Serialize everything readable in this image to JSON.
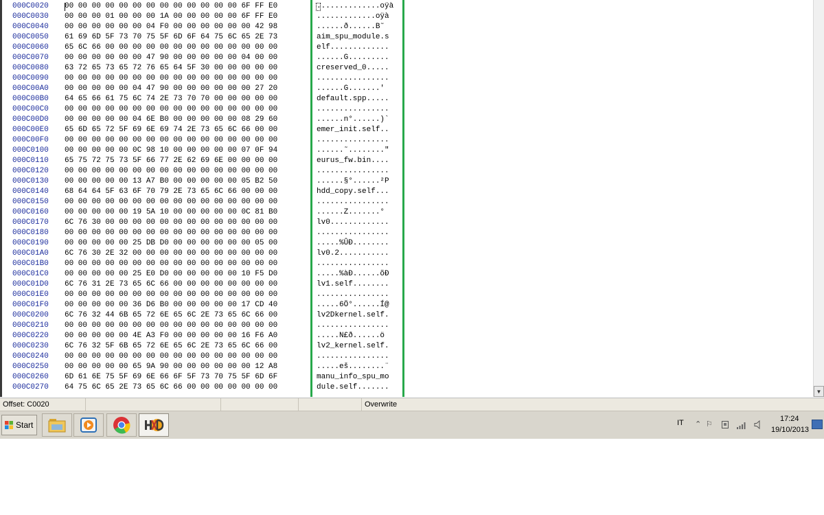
{
  "rows": [
    {
      "offset": "000C0020",
      "hex": "00 00 00 00 00 00 00 00 00 00 00 00 00 6F FF E0",
      "ascii": "..............oÿà"
    },
    {
      "offset": "000C0030",
      "hex": "00 00 00 01 00 00 00 1A 00 00 00 00 00 6F FF E0",
      "ascii": ".............oÿà"
    },
    {
      "offset": "000C0040",
      "hex": "00 00 00 00 00 00 04 F0 00 00 00 00 00 00 42 98",
      "ascii": "......ð......B˜"
    },
    {
      "offset": "000C0050",
      "hex": "61 69 6D 5F 73 70 75 5F 6D 6F 64 75 6C 65 2E 73",
      "ascii": "aim_spu_module.s"
    },
    {
      "offset": "000C0060",
      "hex": "65 6C 66 00 00 00 00 00 00 00 00 00 00 00 00 00",
      "ascii": "elf............."
    },
    {
      "offset": "000C0070",
      "hex": "00 00 00 00 00 00 47 90 00 00 00 00 00 04 00 00",
      "ascii": "......G........."
    },
    {
      "offset": "000C0080",
      "hex": "63 72 65 73 65 72 76 65 64 5F 30 00 00 00 00 00",
      "ascii": "creserved_0....."
    },
    {
      "offset": "000C0090",
      "hex": "00 00 00 00 00 00 00 00 00 00 00 00 00 00 00 00",
      "ascii": "................"
    },
    {
      "offset": "000C00A0",
      "hex": "00 00 00 00 00 04 47 90 00 00 00 00 00 00 27 20",
      "ascii": "......G.......'"
    },
    {
      "offset": "000C00B0",
      "hex": "64 65 66 61 75 6C 74 2E 73 70 70 00 00 00 00 00",
      "ascii": "default.spp....."
    },
    {
      "offset": "000C00C0",
      "hex": "00 00 00 00 00 00 00 00 00 00 00 00 00 00 00 00",
      "ascii": "................"
    },
    {
      "offset": "000C00D0",
      "hex": "00 00 00 00 00 04 6E B0 00 00 00 00 00 08 29 60",
      "ascii": "......n°......)`"
    },
    {
      "offset": "000C00E0",
      "hex": "65 6D 65 72 5F 69 6E 69 74 2E 73 65 6C 66 00 00",
      "ascii": "emer_init.self.."
    },
    {
      "offset": "000C00F0",
      "hex": "00 00 00 00 00 00 00 00 00 00 00 00 00 00 00 00",
      "ascii": "................"
    },
    {
      "offset": "000C0100",
      "hex": "00 00 00 00 00 0C 98 10 00 00 00 00 00 07 0F 94",
      "ascii": "......˜........″"
    },
    {
      "offset": "000C0110",
      "hex": "65 75 72 75 73 5F 66 77 2E 62 69 6E 00 00 00 00",
      "ascii": "eurus_fw.bin...."
    },
    {
      "offset": "000C0120",
      "hex": "00 00 00 00 00 00 00 00 00 00 00 00 00 00 00 00",
      "ascii": "................"
    },
    {
      "offset": "000C0130",
      "hex": "00 00 00 00 00 13 A7 B0 00 00 00 00 00 05 B2 50",
      "ascii": "......§°......²P"
    },
    {
      "offset": "000C0140",
      "hex": "68 64 64 5F 63 6F 70 79 2E 73 65 6C 66 00 00 00",
      "ascii": "hdd_copy.self..."
    },
    {
      "offset": "000C0150",
      "hex": "00 00 00 00 00 00 00 00 00 00 00 00 00 00 00 00",
      "ascii": "................"
    },
    {
      "offset": "000C0160",
      "hex": "00 00 00 00 00 19 5A 10 00 00 00 00 00 0C 81 B0",
      "ascii": "......Z.......°"
    },
    {
      "offset": "000C0170",
      "hex": "6C 76 30 00 00 00 00 00 00 00 00 00 00 00 00 00",
      "ascii": "lv0............."
    },
    {
      "offset": "000C0180",
      "hex": "00 00 00 00 00 00 00 00 00 00 00 00 00 00 00 00",
      "ascii": "................"
    },
    {
      "offset": "000C0190",
      "hex": "00 00 00 00 00 25 DB D0 00 00 00 00 00 00 05 00",
      "ascii": ".....%ÛÐ........"
    },
    {
      "offset": "000C01A0",
      "hex": "6C 76 30 2E 32 00 00 00 00 00 00 00 00 00 00 00",
      "ascii": "lv0.2..........."
    },
    {
      "offset": "000C01B0",
      "hex": "00 00 00 00 00 00 00 00 00 00 00 00 00 00 00 00",
      "ascii": "................"
    },
    {
      "offset": "000C01C0",
      "hex": "00 00 00 00 00 25 E0 D0 00 00 00 00 00 10 F5 D0",
      "ascii": ".....%àÐ......õÐ"
    },
    {
      "offset": "000C01D0",
      "hex": "6C 76 31 2E 73 65 6C 66 00 00 00 00 00 00 00 00",
      "ascii": "lv1.self........"
    },
    {
      "offset": "000C01E0",
      "hex": "00 00 00 00 00 00 00 00 00 00 00 00 00 00 00 00",
      "ascii": "................"
    },
    {
      "offset": "000C01F0",
      "hex": "00 00 00 00 00 36 D6 B0 00 00 00 00 00 17 CD 40",
      "ascii": ".....6Ö°......Í@"
    },
    {
      "offset": "000C0200",
      "hex": "6C 76 32 44 6B 65 72 6E 65 6C 2E 73 65 6C 66 00",
      "ascii": "lv2Dkernel.self."
    },
    {
      "offset": "000C0210",
      "hex": "00 00 00 00 00 00 00 00 00 00 00 00 00 00 00 00",
      "ascii": "................"
    },
    {
      "offset": "000C0220",
      "hex": "00 00 00 00 00 4E A3 F0 00 00 00 00 00 16 F6 A0",
      "ascii": ".....N£ð......ö"
    },
    {
      "offset": "000C0230",
      "hex": "6C 76 32 5F 6B 65 72 6E 65 6C 2E 73 65 6C 66 00",
      "ascii": "lv2_kernel.self."
    },
    {
      "offset": "000C0240",
      "hex": "00 00 00 00 00 00 00 00 00 00 00 00 00 00 00 00",
      "ascii": "................"
    },
    {
      "offset": "000C0250",
      "hex": "00 00 00 00 00 65 9A 90 00 00 00 00 00 00 12 A8",
      "ascii": ".....eš........¨"
    },
    {
      "offset": "000C0260",
      "hex": "6D 61 6E 75 5F 69 6E 66 6F 5F 73 70 75 5F 6D 6F",
      "ascii": "manu_info_spu_mo"
    },
    {
      "offset": "000C0270",
      "hex": "64 75 6C 65 2E 73 65 6C 66 00 00 00 00 00 00 00",
      "ascii": "dule.self......."
    }
  ],
  "status": {
    "offset": "Offset: C0020",
    "mode": "Overwrite"
  },
  "taskbar": {
    "start_label": "Start",
    "language": "IT",
    "time": "17:24",
    "date": "19/10/2013",
    "apps": [
      "file-explorer",
      "media-player",
      "chrome",
      "hxd"
    ]
  },
  "colors": {
    "offset_text": "#1a2b9c",
    "separator_green": "#27a84a"
  }
}
